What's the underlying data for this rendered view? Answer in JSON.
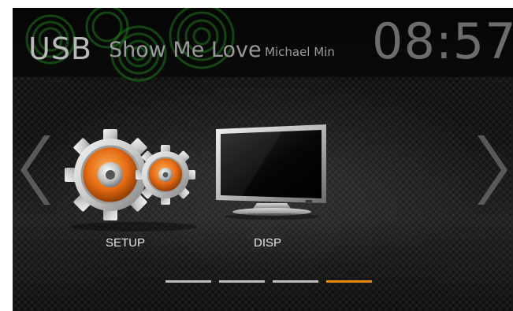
{
  "header": {
    "source": "USB",
    "song_title": "Show Me Love",
    "artist": "Michael Min",
    "clock": "08:57"
  },
  "menu": {
    "items": [
      {
        "label": "SETUP",
        "icon": "gears-icon"
      },
      {
        "label": "DISP",
        "icon": "monitor-icon"
      }
    ]
  },
  "pager": {
    "pages": 4,
    "active_page": 4
  },
  "colors": {
    "accent": "#e88a12",
    "swirl": "#1e7a1e",
    "pager_inactive": "#bdbdbd"
  }
}
